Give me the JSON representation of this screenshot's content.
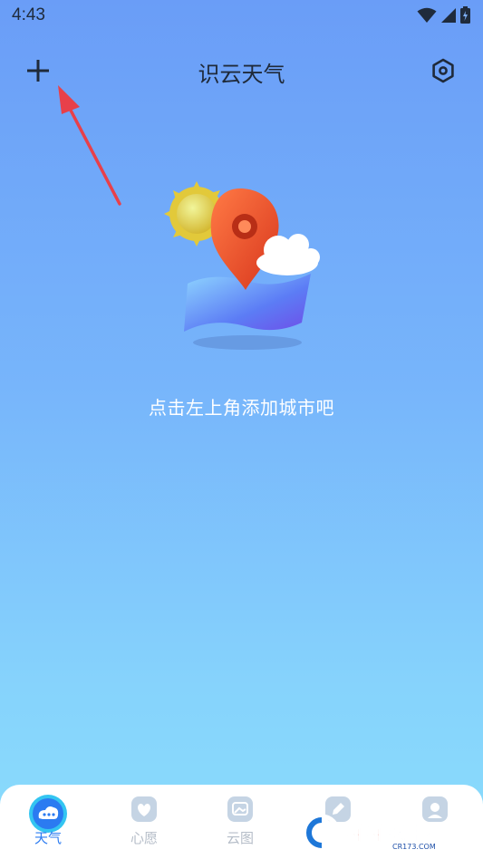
{
  "status": {
    "time": "4:43"
  },
  "header": {
    "title": "识云天气",
    "add_icon": "plus-icon",
    "settings_icon": "hexagon-settings-icon"
  },
  "empty_state": {
    "hint": "点击左上角添加城市吧"
  },
  "tabs": [
    {
      "label": "天气",
      "icon": "cloud-chat-icon",
      "active": true
    },
    {
      "label": "心愿",
      "icon": "heart-card-icon",
      "active": false
    },
    {
      "label": "云图",
      "icon": "image-card-icon",
      "active": false
    },
    {
      "label": "",
      "icon": "pen-card-icon",
      "active": false
    },
    {
      "label": "",
      "icon": "profile-card-icon",
      "active": false
    }
  ],
  "watermark": {
    "text": "西西软件园",
    "sub": "CR173.COM"
  },
  "colors": {
    "accent": "#2b7bf1",
    "bg_top": "#6A9DF7",
    "bg_bottom": "#8ADDFC",
    "arrow": "#E8404A"
  }
}
